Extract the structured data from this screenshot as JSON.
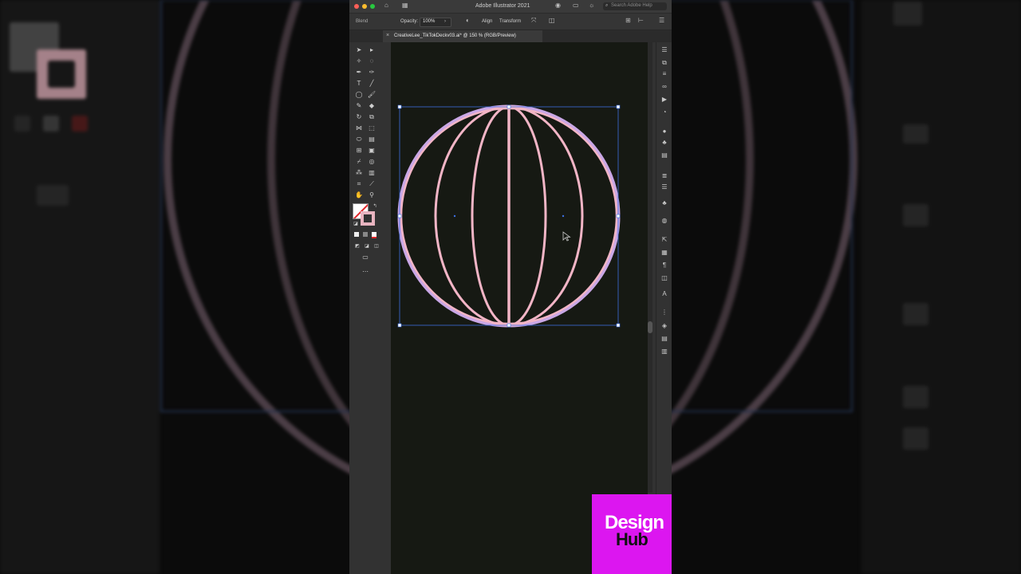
{
  "window": {
    "title": "Adobe Illustrator 2021",
    "search_placeholder": "Search Adobe Help"
  },
  "control_bar": {
    "blend_label": "Blend",
    "opacity_label": "Opacity:",
    "opacity_value": "100%",
    "align_label": "Align",
    "transform_label": "Transform"
  },
  "document": {
    "tab_label": "CreativeLee_TikTokDeckv03.ai* @ 150 % (RGB/Preview)"
  },
  "artwork": {
    "shape": "globe-meridians",
    "stroke_color": "#f2b5c6",
    "outline_color": "#c9a7e6",
    "selection_color": "#3d6fe0"
  },
  "colors": {
    "canvas": "#161913",
    "app_bg": "#323232",
    "logo_bg": "#dc16f0"
  },
  "logo": {
    "line1": "Design",
    "line2": "Hub"
  },
  "icons": {
    "tools": [
      "selection-tool-icon",
      "direct-selection-tool-icon",
      "magic-wand-icon",
      "lasso-icon",
      "pen-tool-icon",
      "curvature-icon",
      "type-tool-icon",
      "line-tool-icon",
      "ellipse-tool-icon",
      "paintbrush-icon",
      "pencil-icon",
      "eraser-icon",
      "rotate-tool-icon",
      "scale-tool-icon",
      "width-tool-icon",
      "free-transform-icon",
      "shape-builder-icon",
      "perspective-grid-icon",
      "mesh-tool-icon",
      "gradient-tool-icon",
      "eyedropper-icon",
      "blend-tool-icon",
      "symbol-sprayer-icon",
      "column-graph-icon",
      "artboard-tool-icon",
      "slice-tool-icon",
      "hand-tool-icon",
      "zoom-tool-icon"
    ],
    "dock": [
      "properties-icon",
      "libraries-icon",
      "layers-icon",
      "links-icon",
      "actions-icon",
      "color-icon",
      "swatches-icon",
      "brushes-icon",
      "symbols-icon",
      "gradient-icon",
      "stroke-icon",
      "transparency-icon",
      "appearance-icon",
      "graphic-styles-icon",
      "export-icon",
      "align-icon",
      "paragraph-icon",
      "character-icon",
      "type-icon",
      "artboards-icon",
      "layers-panel-icon",
      "asset-export-icon",
      "pathfinder-icon"
    ]
  }
}
